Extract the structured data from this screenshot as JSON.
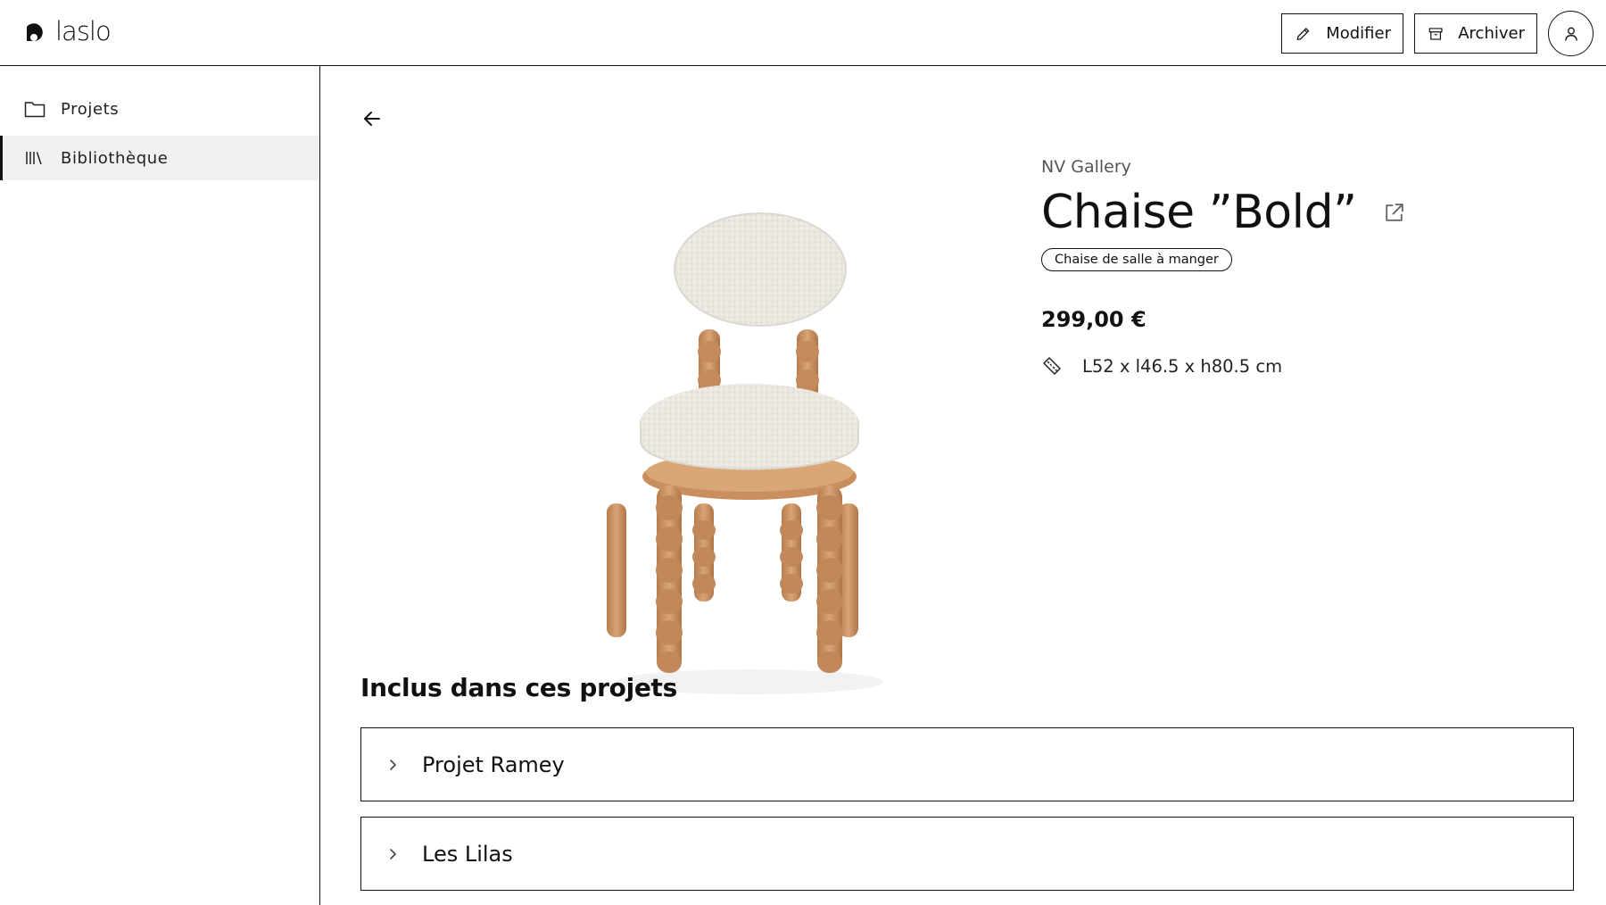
{
  "app": {
    "logo_text": "laslo"
  },
  "header": {
    "edit_label": "Modifier",
    "archive_label": "Archiver"
  },
  "sidebar": {
    "items": [
      {
        "label": "Projets",
        "icon": "folder-icon",
        "active": false
      },
      {
        "label": "Bibliothèque",
        "icon": "library-icon",
        "active": true
      }
    ]
  },
  "product": {
    "brand": "NV Gallery",
    "title": "Chaise ”Bold”",
    "category": "Chaise de salle à manger",
    "price": "299,00 €",
    "dimensions": "L52 x l46.5 x h80.5 cm"
  },
  "projects": {
    "title": "Inclus dans ces projets",
    "items": [
      {
        "label": "Projet Ramey"
      },
      {
        "label": "Les Lilas"
      }
    ]
  },
  "colors": {
    "border": "#111111",
    "active_bg": "#f1f1f1",
    "upholstery": "#e9e6df",
    "wood": "#c98f5e"
  }
}
